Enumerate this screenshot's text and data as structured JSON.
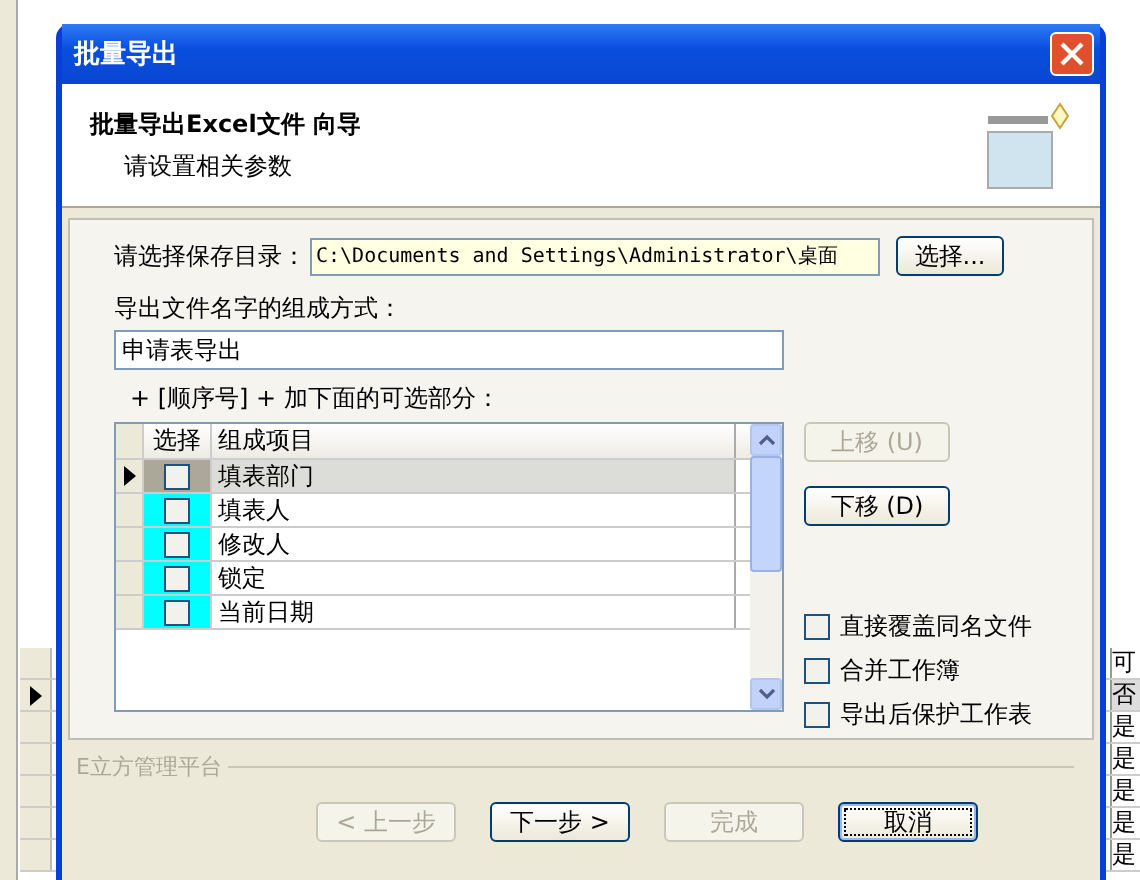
{
  "background_grid": {
    "right_column_header": "可",
    "rows": [
      {
        "cell": "否",
        "selected": true
      },
      {
        "cell": "是",
        "selected": false
      },
      {
        "cell": "是",
        "selected": false
      },
      {
        "cell": "是",
        "selected": false
      },
      {
        "cell": "是",
        "selected": false
      },
      {
        "cell": "是",
        "selected": false
      }
    ]
  },
  "window": {
    "title": "批量导出"
  },
  "header": {
    "title": "批量导出Excel文件 向导",
    "subtitle": "请设置相关参数"
  },
  "save_dir": {
    "label": "请选择保存目录：",
    "value": "C:\\Documents and Settings\\Administrator\\桌面",
    "button": "选择..."
  },
  "file_name": {
    "label": "导出文件名字的组成方式：",
    "value": "申请表导出"
  },
  "optional_label": "+ [顺序号] + 加下面的可选部分：",
  "table": {
    "columns": [
      "选择",
      "组成项目"
    ],
    "rows": [
      {
        "name": "填表部门",
        "checked": false,
        "selected": true
      },
      {
        "name": "填表人",
        "checked": false,
        "selected": false
      },
      {
        "name": "修改人",
        "checked": false,
        "selected": false
      },
      {
        "name": "锁定",
        "checked": false,
        "selected": false
      },
      {
        "name": "当前日期",
        "checked": false,
        "selected": false
      }
    ]
  },
  "move_buttons": [
    {
      "label": "上移 (U)",
      "disabled": true
    },
    {
      "label": "下移 (D)",
      "disabled": false
    }
  ],
  "options": [
    {
      "label": "直接覆盖同名文件",
      "checked": false
    },
    {
      "label": "合并工作簿",
      "checked": false
    },
    {
      "label": "导出后保护工作表",
      "checked": false
    }
  ],
  "footer_group": "E立方管理平台",
  "buttons": [
    {
      "label": "< 上一步",
      "disabled": true,
      "focused": false
    },
    {
      "label": "下一步 >",
      "disabled": false,
      "focused": false
    },
    {
      "label": "完成",
      "disabled": true,
      "focused": false
    },
    {
      "label": "取消",
      "disabled": false,
      "focused": true
    }
  ]
}
